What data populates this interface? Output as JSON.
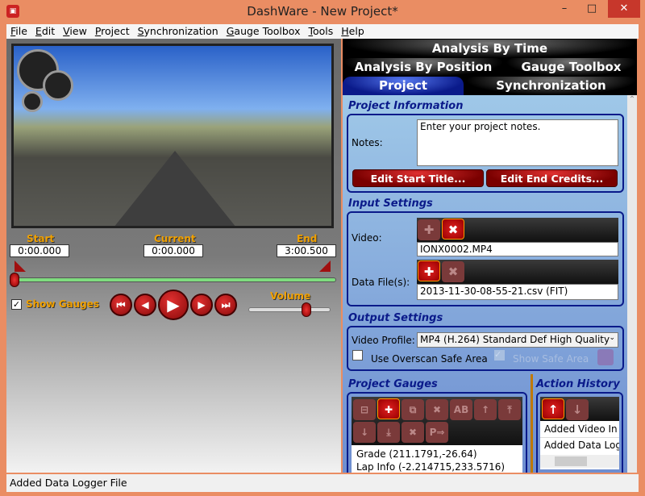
{
  "window": {
    "title": "DashWare - New Project*",
    "minimize": "–",
    "maximize": "□",
    "close": "✕",
    "app_icon": "dashware-icon"
  },
  "menu": [
    "File",
    "Edit",
    "View",
    "Project",
    "Synchronization",
    "Gauge Toolbox",
    "Tools",
    "Help"
  ],
  "player": {
    "start_label": "Start",
    "current_label": "Current",
    "end_label": "End",
    "start": "0:00.000",
    "current": "0:00.000",
    "end": "3:00.500",
    "timeline_position": 0,
    "show_gauges_label": "Show Gauges",
    "show_gauges_checked": true,
    "volume_label": "Volume",
    "volume_level": 0.72,
    "buttons": [
      {
        "icon": "skip-to-start-icon",
        "glyph": "⏮"
      },
      {
        "icon": "step-back-icon",
        "glyph": "◀"
      },
      {
        "icon": "play-icon",
        "glyph": "▶"
      },
      {
        "icon": "step-forward-icon",
        "glyph": "▶"
      },
      {
        "icon": "skip-to-end-icon",
        "glyph": "⏭"
      }
    ]
  },
  "tabs": {
    "row1": [
      "Analysis By Time"
    ],
    "row2": [
      "Analysis By Position",
      "Gauge Toolbox"
    ],
    "row3": [
      "Project",
      "Synchronization"
    ],
    "selected": "Project"
  },
  "project_info": {
    "heading": "Project Information",
    "notes_label": "Notes:",
    "notes_value": "Enter your project notes.",
    "edit_start": "Edit Start Title...",
    "edit_end": "Edit End Credits..."
  },
  "input_settings": {
    "heading": "Input Settings",
    "video_label": "Video:",
    "video_file": "IONX0002.MP4",
    "data_label": "Data File(s):",
    "data_file": "2013-11-30-08-55-21.csv (FIT)"
  },
  "output_settings": {
    "heading": "Output Settings",
    "profile_label": "Video Profile:",
    "profile_value": "MP4 (H.264) Standard Def High Quality",
    "overscan_label": "Use Overscan Safe Area",
    "safe_area_label": "Show Safe Area"
  },
  "gauges": {
    "heading": "Project Gauges",
    "items": [
      "Grade (211.1791,-26.64)",
      "Lap Info (-2.214715,233.5716)"
    ],
    "toolbar": [
      {
        "icon": "gauge-list-icon",
        "g": "⊟"
      },
      {
        "icon": "add-icon",
        "g": "✚",
        "on": true
      },
      {
        "icon": "duplicate-icon",
        "g": "⧉"
      },
      {
        "icon": "tools-icon",
        "g": "✖"
      },
      {
        "icon": "rename-icon",
        "g": "AB"
      },
      {
        "icon": "move-up-icon",
        "g": "↑"
      },
      {
        "icon": "move-top-icon",
        "g": "⤒"
      },
      {
        "icon": "move-down-icon",
        "g": "↓"
      },
      {
        "icon": "move-bottom-icon",
        "g": "⤓"
      },
      {
        "icon": "delete-icon",
        "g": "✖"
      },
      {
        "icon": "properties-icon",
        "g": "P⇒"
      }
    ]
  },
  "history": {
    "heading": "Action History",
    "items": [
      "Added Video In",
      "Added Data Log"
    ]
  },
  "status": "Added Data Logger File"
}
